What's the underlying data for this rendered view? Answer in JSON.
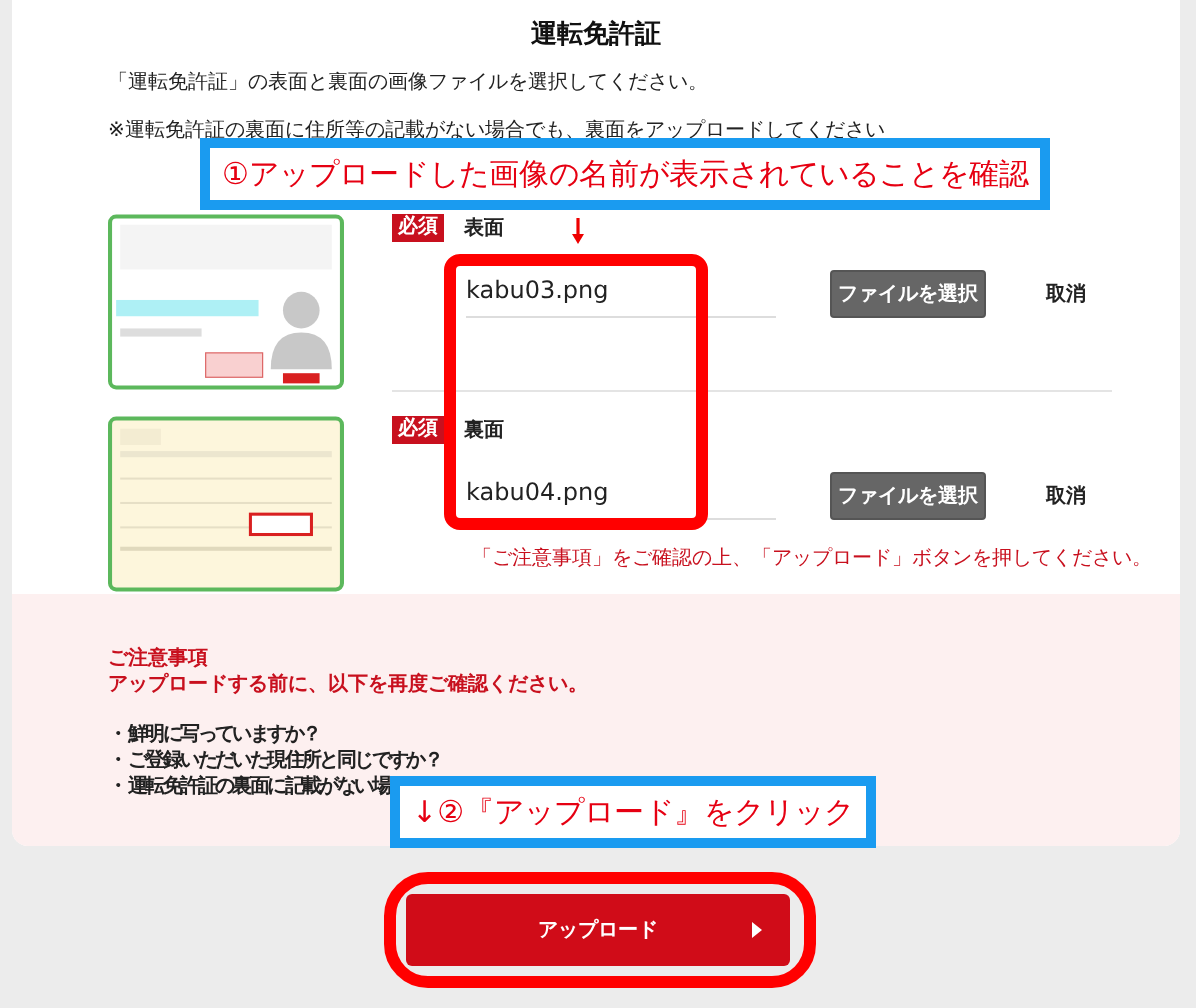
{
  "title": "運転免許証",
  "intro": "「運転免許証」の表面と裏面の画像ファイルを選択してください。",
  "note": "※運転免許証の裏面に住所等の記載がない場合でも、裏面をアップロードしてください",
  "sides": [
    {
      "kind": "front",
      "badge": "必須",
      "label": "表面",
      "file": "kabu03.png",
      "button": "ファイルを選択",
      "cancel": "取消"
    },
    {
      "kind": "back",
      "badge": "必須",
      "label": "裏面",
      "file": "kabu04.png",
      "button": "ファイルを選択",
      "cancel": "取消"
    }
  ],
  "hint": "「ご注意事項」をご確認の上、「アップロード」ボタンを押してください。",
  "caution": {
    "title": "ご注意事項",
    "lead": "アップロードする前に、以下を再度ご確認ください。",
    "items": [
      {
        "bullet": "・",
        "text": "鮮明に写っていますか？"
      },
      {
        "bullet": "・",
        "text": "ご登録いただいた現住所と同じですか？"
      },
      {
        "bullet": "・",
        "text": "運転免許証の裏面に記載がない場"
      }
    ]
  },
  "upload_button": {
    "label": "アップロード"
  },
  "annotations": [
    {
      "kind": "filenames",
      "text": "①アップロードした画像の名前が表示されていることを確認"
    },
    {
      "kind": "upload",
      "text": "↓②『アップロード』をクリック"
    }
  ]
}
